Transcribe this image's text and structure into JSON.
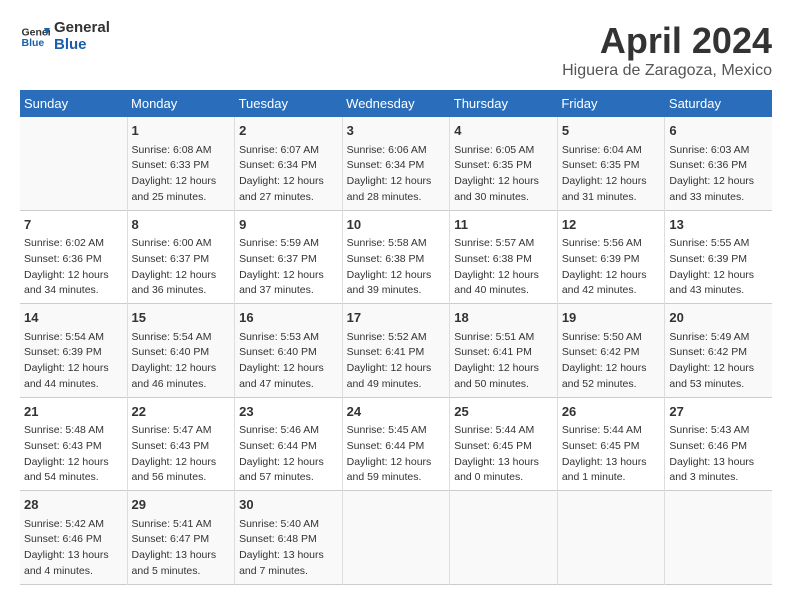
{
  "header": {
    "logo_line1": "General",
    "logo_line2": "Blue",
    "title": "April 2024",
    "subtitle": "Higuera de Zaragoza, Mexico"
  },
  "calendar": {
    "days_of_week": [
      "Sunday",
      "Monday",
      "Tuesday",
      "Wednesday",
      "Thursday",
      "Friday",
      "Saturday"
    ],
    "weeks": [
      [
        {
          "day": "",
          "content": ""
        },
        {
          "day": "1",
          "content": "Sunrise: 6:08 AM\nSunset: 6:33 PM\nDaylight: 12 hours\nand 25 minutes."
        },
        {
          "day": "2",
          "content": "Sunrise: 6:07 AM\nSunset: 6:34 PM\nDaylight: 12 hours\nand 27 minutes."
        },
        {
          "day": "3",
          "content": "Sunrise: 6:06 AM\nSunset: 6:34 PM\nDaylight: 12 hours\nand 28 minutes."
        },
        {
          "day": "4",
          "content": "Sunrise: 6:05 AM\nSunset: 6:35 PM\nDaylight: 12 hours\nand 30 minutes."
        },
        {
          "day": "5",
          "content": "Sunrise: 6:04 AM\nSunset: 6:35 PM\nDaylight: 12 hours\nand 31 minutes."
        },
        {
          "day": "6",
          "content": "Sunrise: 6:03 AM\nSunset: 6:36 PM\nDaylight: 12 hours\nand 33 minutes."
        }
      ],
      [
        {
          "day": "7",
          "content": "Sunrise: 6:02 AM\nSunset: 6:36 PM\nDaylight: 12 hours\nand 34 minutes."
        },
        {
          "day": "8",
          "content": "Sunrise: 6:00 AM\nSunset: 6:37 PM\nDaylight: 12 hours\nand 36 minutes."
        },
        {
          "day": "9",
          "content": "Sunrise: 5:59 AM\nSunset: 6:37 PM\nDaylight: 12 hours\nand 37 minutes."
        },
        {
          "day": "10",
          "content": "Sunrise: 5:58 AM\nSunset: 6:38 PM\nDaylight: 12 hours\nand 39 minutes."
        },
        {
          "day": "11",
          "content": "Sunrise: 5:57 AM\nSunset: 6:38 PM\nDaylight: 12 hours\nand 40 minutes."
        },
        {
          "day": "12",
          "content": "Sunrise: 5:56 AM\nSunset: 6:39 PM\nDaylight: 12 hours\nand 42 minutes."
        },
        {
          "day": "13",
          "content": "Sunrise: 5:55 AM\nSunset: 6:39 PM\nDaylight: 12 hours\nand 43 minutes."
        }
      ],
      [
        {
          "day": "14",
          "content": "Sunrise: 5:54 AM\nSunset: 6:39 PM\nDaylight: 12 hours\nand 44 minutes."
        },
        {
          "day": "15",
          "content": "Sunrise: 5:54 AM\nSunset: 6:40 PM\nDaylight: 12 hours\nand 46 minutes."
        },
        {
          "day": "16",
          "content": "Sunrise: 5:53 AM\nSunset: 6:40 PM\nDaylight: 12 hours\nand 47 minutes."
        },
        {
          "day": "17",
          "content": "Sunrise: 5:52 AM\nSunset: 6:41 PM\nDaylight: 12 hours\nand 49 minutes."
        },
        {
          "day": "18",
          "content": "Sunrise: 5:51 AM\nSunset: 6:41 PM\nDaylight: 12 hours\nand 50 minutes."
        },
        {
          "day": "19",
          "content": "Sunrise: 5:50 AM\nSunset: 6:42 PM\nDaylight: 12 hours\nand 52 minutes."
        },
        {
          "day": "20",
          "content": "Sunrise: 5:49 AM\nSunset: 6:42 PM\nDaylight: 12 hours\nand 53 minutes."
        }
      ],
      [
        {
          "day": "21",
          "content": "Sunrise: 5:48 AM\nSunset: 6:43 PM\nDaylight: 12 hours\nand 54 minutes."
        },
        {
          "day": "22",
          "content": "Sunrise: 5:47 AM\nSunset: 6:43 PM\nDaylight: 12 hours\nand 56 minutes."
        },
        {
          "day": "23",
          "content": "Sunrise: 5:46 AM\nSunset: 6:44 PM\nDaylight: 12 hours\nand 57 minutes."
        },
        {
          "day": "24",
          "content": "Sunrise: 5:45 AM\nSunset: 6:44 PM\nDaylight: 12 hours\nand 59 minutes."
        },
        {
          "day": "25",
          "content": "Sunrise: 5:44 AM\nSunset: 6:45 PM\nDaylight: 13 hours\nand 0 minutes."
        },
        {
          "day": "26",
          "content": "Sunrise: 5:44 AM\nSunset: 6:45 PM\nDaylight: 13 hours\nand 1 minute."
        },
        {
          "day": "27",
          "content": "Sunrise: 5:43 AM\nSunset: 6:46 PM\nDaylight: 13 hours\nand 3 minutes."
        }
      ],
      [
        {
          "day": "28",
          "content": "Sunrise: 5:42 AM\nSunset: 6:46 PM\nDaylight: 13 hours\nand 4 minutes."
        },
        {
          "day": "29",
          "content": "Sunrise: 5:41 AM\nSunset: 6:47 PM\nDaylight: 13 hours\nand 5 minutes."
        },
        {
          "day": "30",
          "content": "Sunrise: 5:40 AM\nSunset: 6:48 PM\nDaylight: 13 hours\nand 7 minutes."
        },
        {
          "day": "",
          "content": ""
        },
        {
          "day": "",
          "content": ""
        },
        {
          "day": "",
          "content": ""
        },
        {
          "day": "",
          "content": ""
        }
      ]
    ]
  }
}
